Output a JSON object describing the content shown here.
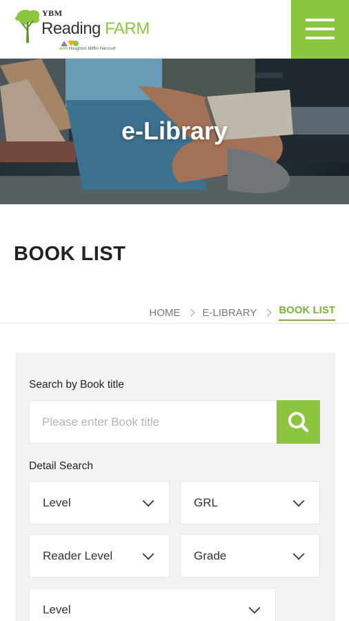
{
  "header": {
    "logo": {
      "brand": "YBM",
      "title_part1": "Reading",
      "title_part2": "FARM",
      "with_text": "with",
      "partner": "Houghton Mifflin Harcourt"
    },
    "menu_icon": "hamburger-icon",
    "accent_color": "#8cc63f"
  },
  "hero": {
    "title": "e-Library"
  },
  "page": {
    "title": "BOOK LIST"
  },
  "breadcrumb": {
    "items": [
      "HOME",
      "E-LIBRARY",
      "BOOK LIST"
    ],
    "active_index": 2,
    "active_color": "#7ab33a"
  },
  "search": {
    "title_label": "Search by Book title",
    "placeholder": "Please enter Book title",
    "button_icon": "search-icon",
    "detail_label": "Detail Search",
    "selects": [
      "Level",
      "GRL",
      "Reader Level",
      "Grade",
      "Level"
    ]
  }
}
